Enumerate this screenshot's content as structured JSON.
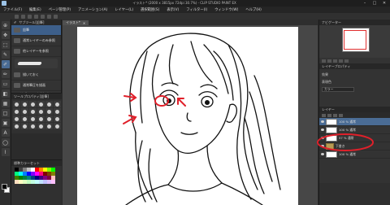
{
  "window": {
    "title": "イラスト* (2000 x 3815px 72dpi 30.7%) - CLIP STUDIO PAINT EX",
    "controls": [
      "–",
      "□",
      "✕"
    ]
  },
  "menu": [
    "ファイル(F)",
    "編集(E)",
    "ページ管理(P)",
    "アニメーション(A)",
    "レイヤー(L)",
    "選択範囲(S)",
    "表示(V)",
    "フィルター(I)",
    "ウィンドウ(W)",
    "ヘルプ(H)"
  ],
  "subtool": {
    "header": "サブツール[鉛筆]",
    "items": [
      {
        "label": "鉛筆",
        "selected": true
      },
      {
        "label": "通常レイヤーのみ参照",
        "selected": false
      },
      {
        "label": "他レイヤーを参照",
        "selected": false
      },
      {
        "label": "描いておく",
        "selected": false
      },
      {
        "label": "通常筆圧を描画",
        "selected": false
      }
    ],
    "add_label": "サブツールを追加する"
  },
  "tool_property": {
    "header": "ツールプロパティ[鉛筆]"
  },
  "color_set": {
    "header": "標準カラーセット",
    "colors": [
      "#000000",
      "#404040",
      "#808080",
      "#c0c0c0",
      "#ffffff",
      "#ff0000",
      "#ff8000",
      "#ffff00",
      "#80ff00",
      "#00ff00",
      "#00ff80",
      "#00ffff",
      "#0080ff",
      "#0000ff",
      "#8000ff",
      "#ff00ff",
      "#ff0080",
      "#800000",
      "#804000",
      "#808000",
      "#408000",
      "#008000",
      "#008040",
      "#008080",
      "#004080",
      "#000080",
      "#400080",
      "#800080",
      "#800040",
      "#ffc0c0",
      "#ffe0c0",
      "#ffffc0",
      "#e0ffc0",
      "#c0ffc0",
      "#c0ffe0",
      "#c0ffff",
      "#c0e0ff",
      "#c0c0ff",
      "#e0c0ff",
      "#ffc0ff"
    ]
  },
  "canvas_tab": {
    "label": "イラスト*",
    "close": "✕"
  },
  "right": {
    "navigator_header": "ナビゲーター",
    "layer_property_header": "レイヤープロパティ",
    "effect_label": "効果",
    "expression_label": "表現色",
    "expression_value": "カラー",
    "layer_header": "レイヤー",
    "blend_label": "通常",
    "layers": [
      {
        "name": "100 % 通常",
        "sub": "レイヤー 1",
        "type": "raster",
        "selected": true
      },
      {
        "name": "100 % 通常",
        "sub": "下書き",
        "type": "raster",
        "selected": false
      },
      {
        "name": "57 % 通常",
        "sub": "下書き",
        "type": "raster",
        "selected": false
      },
      {
        "name": "下書き",
        "sub": "",
        "type": "folder",
        "selected": false
      },
      {
        "name": "100 % 通常",
        "sub": "用紙",
        "type": "paper",
        "selected": false
      }
    ]
  },
  "colors": {
    "annotation_red": "#e0202a",
    "selection_blue": "#4a6c95"
  },
  "icons": [
    "pen-icon",
    "eraser-icon",
    "brush-icon",
    "select-icon",
    "move-icon",
    "eye-icon",
    "folder-icon",
    "close-icon"
  ]
}
